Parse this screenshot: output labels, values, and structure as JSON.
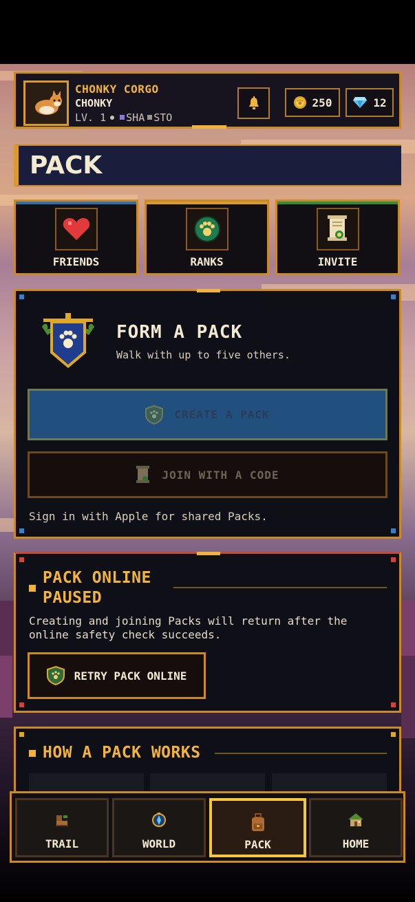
{
  "profile": {
    "display_name": "CHONKY CORGO",
    "nickname": "CHONKY",
    "level": "LV. 1",
    "tag_a": "SHA",
    "tag_b": "STO",
    "coins": "250",
    "gems": "12"
  },
  "page_title": "PACK",
  "nav_cards": [
    {
      "label": "FRIENDS",
      "icon": "heart-icon",
      "accent": "#2f6fb0"
    },
    {
      "label": "RANKS",
      "icon": "paw-badge-icon",
      "accent": "#d99a2f"
    },
    {
      "label": "INVITE",
      "icon": "scroll-icon",
      "accent": "#2e8a3c"
    }
  ],
  "form_pack": {
    "title": "FORM A PACK",
    "subtitle": "Walk with up to five others.",
    "create_label": "CREATE A PACK",
    "join_label": "JOIN WITH A CODE",
    "signin_note": "Sign in with Apple for shared Packs."
  },
  "online_status": {
    "heading_line1": "PACK ONLINE",
    "heading_line2": "PAUSED",
    "body_line1": "Creating and joining Packs will return after the",
    "body_line2": "online safety check succeeds.",
    "retry_label": "RETRY PACK ONLINE"
  },
  "how_it_works": {
    "heading": "HOW A PACK WORKS"
  },
  "tabs": [
    {
      "label": "TRAIL",
      "icon": "boot-icon",
      "active": false
    },
    {
      "label": "WORLD",
      "icon": "compass-icon",
      "active": false
    },
    {
      "label": "PACK",
      "icon": "backpack-icon",
      "active": true
    },
    {
      "label": "HOME",
      "icon": "house-icon",
      "active": false
    }
  ],
  "colors": {
    "gold": "#c98a28",
    "accent_yellow": "#f2b43a",
    "create_blue": "#22507e",
    "panel_bg": "#0f0f17",
    "title_bar_bg": "#1a1d3c"
  }
}
